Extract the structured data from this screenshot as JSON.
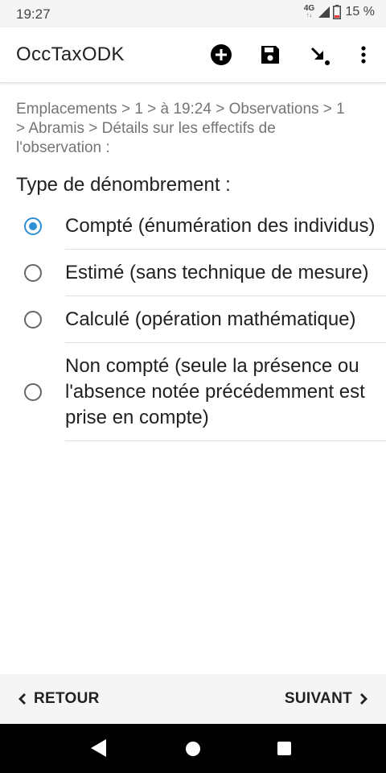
{
  "status_bar": {
    "time": "19:27",
    "network": "4G",
    "network_sub": "↑↓",
    "battery": "15 %"
  },
  "app_bar": {
    "title": "OccTaxODK",
    "icons": [
      "add-circle-icon",
      "save-icon",
      "jump-icon",
      "more-vert-icon"
    ]
  },
  "breadcrumb": "Emplacements > 1 > à 19:24 > Observations > 1 > Abramis > Détails sur les effectifs de l'observation :",
  "question": "Type de dénombrement :",
  "options": [
    {
      "label": "Compté (énumération des individus)",
      "checked": true
    },
    {
      "label": "Estimé (sans technique de mesure)",
      "checked": false
    },
    {
      "label": "Calculé (opération mathématique)",
      "checked": false
    },
    {
      "label": "Non compté (seule la présence ou l'absence notée précédemment est prise en compte)",
      "checked": false
    }
  ],
  "navigation": {
    "back_label": "RETOUR",
    "next_label": "SUIVANT"
  },
  "colors": {
    "accent": "#2e8fd4",
    "toolbar_icon": "#000000",
    "nav_bg": "#f5f5f5"
  }
}
